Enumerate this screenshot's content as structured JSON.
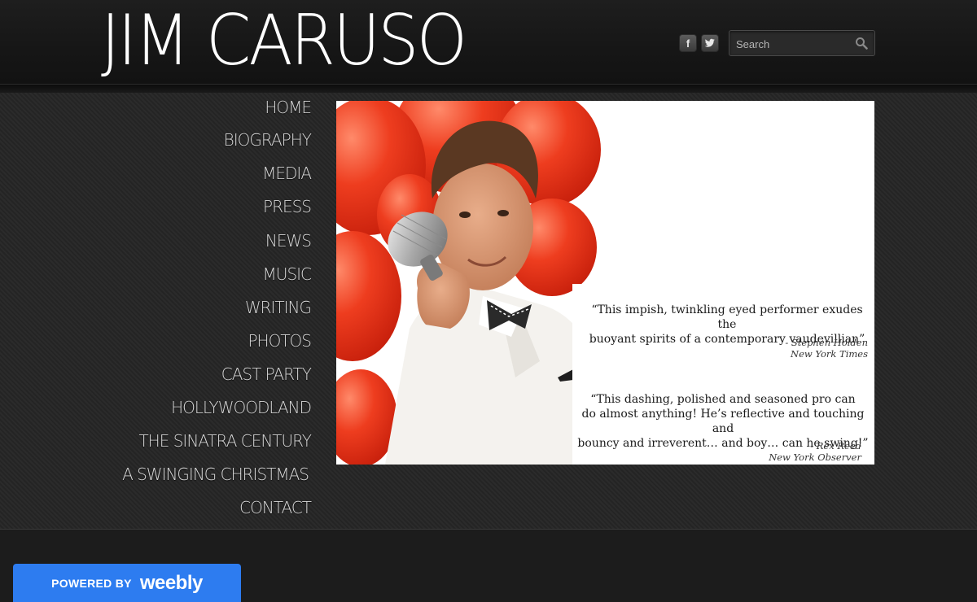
{
  "header": {
    "site_title": "JIM CARUSO",
    "facebook_icon_label": "f",
    "search": {
      "placeholder": "Search"
    }
  },
  "nav": {
    "items": [
      {
        "label": "HOME"
      },
      {
        "label": "BIOGRAPHY"
      },
      {
        "label": "MEDIA"
      },
      {
        "label": "PRESS"
      },
      {
        "label": "NEWS"
      },
      {
        "label": "MUSIC"
      },
      {
        "label": "WRITING"
      },
      {
        "label": "PHOTOS"
      },
      {
        "label": "CAST PARTY"
      },
      {
        "label": "HOLLYWOODLAND"
      },
      {
        "label": "THE SINATRA CENTURY"
      },
      {
        "label": "A SWINGING CHRISTMAS"
      },
      {
        "label": "CONTACT"
      }
    ]
  },
  "hero": {
    "quotes": [
      {
        "line1": "“This impish, twinkling eyed performer exudes the",
        "line2": "buoyant spirits of a contemporary vaudevillian”",
        "author": "- Stephen Holden",
        "source": "New York Times"
      },
      {
        "line1": "“This dashing, polished and seasoned pro can",
        "line2": "do almost anything! He’s reflective and touching and",
        "line3": "bouncy and irreverent… and boy… can he swing!”",
        "author": "- Rex Reed",
        "source": "New York Observer"
      }
    ]
  },
  "footer": {
    "powered_by": "POWERED BY",
    "brand": "weebly"
  },
  "colors": {
    "accent": "#2d7cf0",
    "balloon": "#e8391f",
    "background": "#1b1b1b"
  }
}
